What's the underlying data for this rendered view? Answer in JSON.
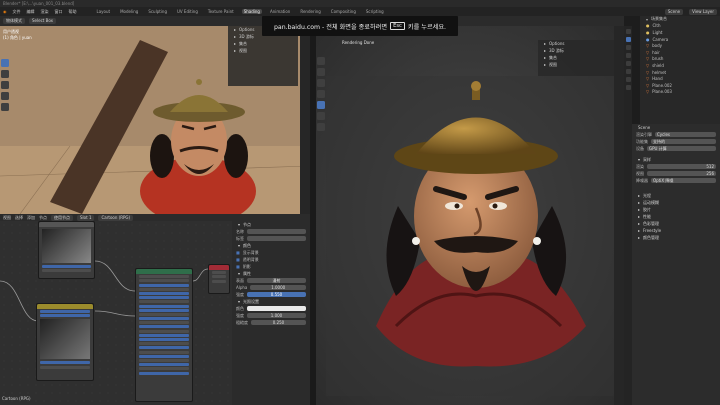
{
  "title_bar": {
    "text": "Blender* [E:\\...\\yuan_001_03.blend]"
  },
  "menu": {
    "items": [
      "文件",
      "编辑",
      "渲染",
      "窗口",
      "帮助"
    ],
    "workspaces": [
      "Layout",
      "Modeling",
      "Sculpting",
      "UV Editing",
      "Texture Paint",
      "Shading",
      "Animation",
      "Rendering",
      "Compositing",
      "Scripting"
    ],
    "active_workspace": "Shading"
  },
  "top_right": {
    "scene": "Scene",
    "view_layer": "View Layer"
  },
  "overlay": {
    "message_pre": "pan.baidu.com - 전체 화면을 종료하려면",
    "key": "Esc",
    "message_post": "키를 누르세요."
  },
  "left_viewport": {
    "header_mode": "物体模式",
    "select_box": "Select Box",
    "view_label": "用户透视",
    "collection": "(1) 角色 | yuan",
    "panel_items": [
      "Options",
      "3D 游标",
      "集合",
      "视图"
    ]
  },
  "right_viewport": {
    "status": "Rendering Done",
    "panel_items": [
      "Options",
      "3D 游标",
      "集合",
      "视图"
    ]
  },
  "node_editor": {
    "header_items": [
      "视图",
      "选择",
      "添加",
      "节点"
    ],
    "use_nodes": "使用节点",
    "slot": "Slot 1",
    "material": "Cartoon (RPG)",
    "footer": "Cartoon (RPG)"
  },
  "side_panel": {
    "section_node": "节点",
    "name_label": "名称",
    "label_label": "标签",
    "section_color": "颜色",
    "section_props": "属性",
    "section_emission": "光照设置",
    "props": {
      "surface_label": "表面",
      "surface_value": "漫射",
      "alpha_label": "Alpha",
      "alpha_value": "1.0000",
      "factor_label": "强度",
      "factor_value": "0.550"
    },
    "color_rows": [
      {
        "label": "颜色",
        "value": ""
      },
      {
        "label": "强度",
        "value": "1.000"
      },
      {
        "label": "粗糙度",
        "value": "0.250"
      }
    ],
    "checks": [
      "显示背景",
      "透明背景",
      "阴影"
    ]
  },
  "outliner": {
    "items": [
      "场景集合",
      "Clth",
      "Light",
      "Camera",
      "body",
      "hair",
      "brush",
      "shield",
      "helmet",
      "Hand",
      "Plane.002",
      "Plane.003"
    ]
  },
  "properties": {
    "scene": "Scene",
    "engine_label": "渲染引擎",
    "engine_value": "Cycles",
    "feature_label": "功能集",
    "feature_value": "支持的",
    "device_label": "设备",
    "device_value": "GPU 计算",
    "sections": [
      "采样",
      "光程",
      "运动模糊",
      "胶片",
      "性能",
      "色彩管理",
      "Freestyle",
      "颜色管理"
    ],
    "sampling": {
      "render_label": "渲染",
      "render_value": "512",
      "viewport_label": "视图",
      "viewport_value": "256"
    },
    "denoise_label": "降噪器",
    "denoise_value": "OptiX 降噪"
  },
  "colors": {
    "accent": "#4872b4",
    "node_header_green": "#2f6e4a",
    "node_header_red": "#a22b36",
    "node_header_yellow": "#9b8b2c",
    "node_header_gray": "#555555"
  }
}
